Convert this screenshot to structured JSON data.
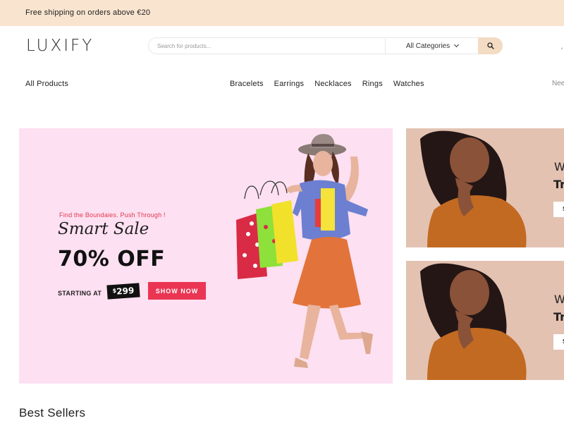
{
  "topbar": {
    "text": "Free shipping on orders above €20"
  },
  "header": {
    "logo": "LUXIFY",
    "search": {
      "placeholder": "Search for products...",
      "category": "All Categories",
      "icon": "search-icon"
    },
    "corner_icon": "user-icon"
  },
  "nav": {
    "all_products": "All Products",
    "items": [
      {
        "label": "Bracelets"
      },
      {
        "label": "Earrings"
      },
      {
        "label": "Necklaces"
      },
      {
        "label": "Rings"
      },
      {
        "label": "Watches"
      }
    ],
    "help_text": "Need"
  },
  "hero": {
    "kicker": "Find the Boundaies. Push Through !",
    "title": "Smart Sale",
    "discount": "70% OFF",
    "starting_label": "STARTING AT",
    "price_currency": "$",
    "price_value": "299",
    "button": "SHOW NOW",
    "colors": {
      "background": "#fde0f1",
      "accent": "#ea3553"
    }
  },
  "side_banners": [
    {
      "heading": "W",
      "subheading": "Tr",
      "button": "S"
    },
    {
      "heading": "W",
      "subheading": "Tr",
      "button": "S"
    }
  ],
  "section": {
    "best_sellers": "Best Sellers"
  }
}
